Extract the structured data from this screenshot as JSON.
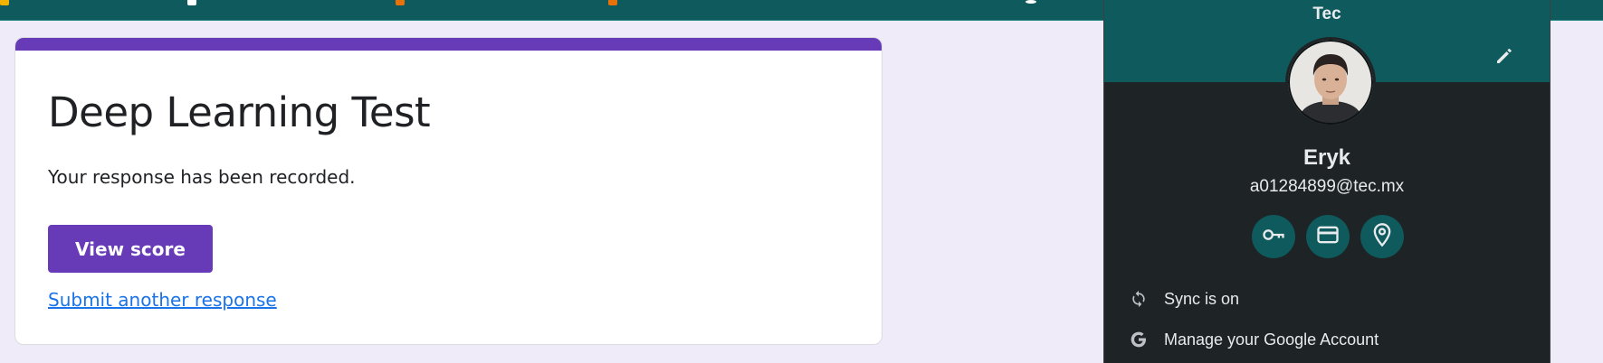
{
  "form": {
    "title": "Deep Learning Test",
    "message": "Your response has been recorded.",
    "view_score_label": "View score",
    "submit_another_label": "Submit another response",
    "accent_color": "#673ab7"
  },
  "profile": {
    "org": "Tec",
    "name": "Eryk",
    "email": "a01284899@tec.mx",
    "quick_actions": [
      {
        "icon": "key-icon",
        "label": "Passwords"
      },
      {
        "icon": "credit-card-icon",
        "label": "Payment methods"
      },
      {
        "icon": "location-pin-icon",
        "label": "Addresses"
      }
    ],
    "menu": [
      {
        "icon": "sync-icon",
        "label": "Sync is on"
      },
      {
        "icon": "google-icon",
        "label": "Manage your Google Account"
      }
    ],
    "header_color": "#0e5a5c"
  }
}
